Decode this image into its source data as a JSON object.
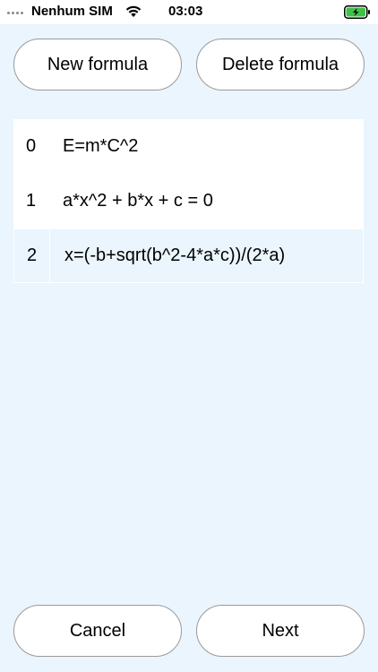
{
  "status_bar": {
    "carrier": "Nenhum SIM",
    "time": "03:03",
    "icons": [
      "signal-dots-icon",
      "wifi-icon",
      "battery-charging-icon"
    ],
    "battery_color": "#3fc24a"
  },
  "toolbar": {
    "new_label": "New formula",
    "delete_label": "Delete formula"
  },
  "formulas": [
    {
      "index": "0",
      "formula": "E=m*C^2"
    },
    {
      "index": "1",
      "formula": "a*x^2 + b*x + c = 0"
    },
    {
      "index": "2",
      "formula": "x=(-b+sqrt(b^2-4*a*c))/(2*a)"
    }
  ],
  "selected_index": 2,
  "footer": {
    "cancel_label": "Cancel",
    "next_label": "Next"
  },
  "colors": {
    "background": "#eaf5fd",
    "row_background": "#ffffff",
    "button_border": "#9a9a9a"
  }
}
